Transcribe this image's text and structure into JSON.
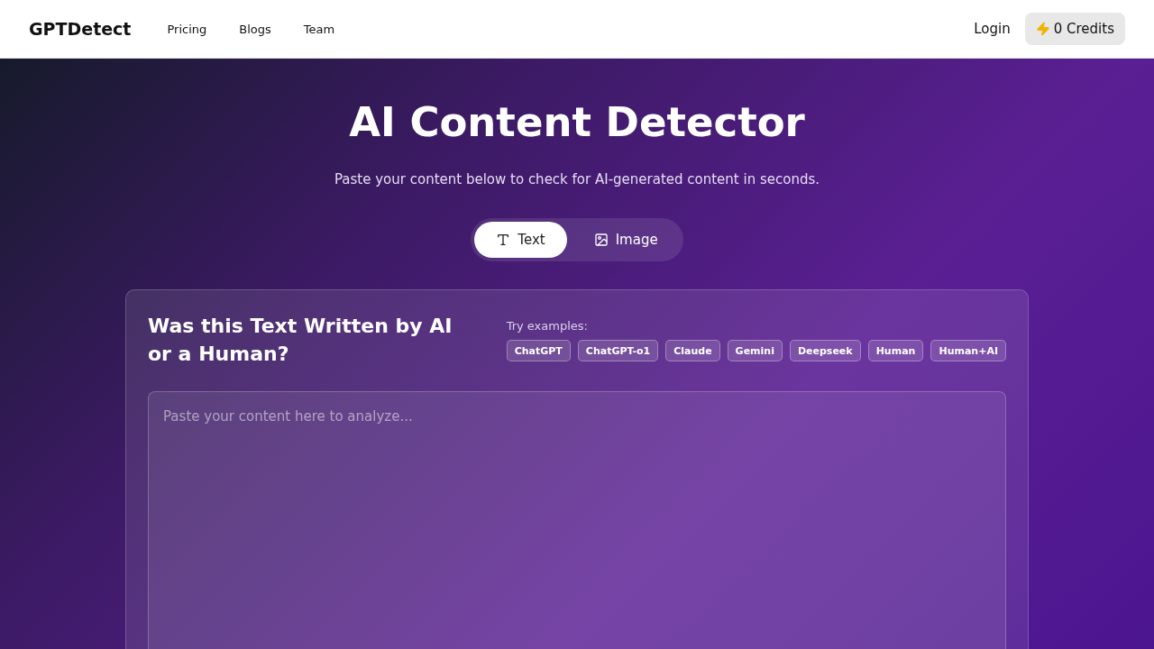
{
  "header": {
    "logo": "GPTDetect",
    "nav": [
      "Pricing",
      "Blogs",
      "Team"
    ],
    "login": "Login",
    "credits": "0 Credits"
  },
  "hero": {
    "title": "AI Content Detector",
    "subtitle": "Paste your content below to check for AI-generated content in seconds."
  },
  "tabs": [
    {
      "label": "Text",
      "kind": "text",
      "selected": true
    },
    {
      "label": "Image",
      "kind": "image",
      "selected": false
    }
  ],
  "card": {
    "heading": "Was this Text Written by AI or a Human?",
    "examples_label": "Try examples:",
    "examples": [
      "ChatGPT",
      "ChatGPT-o1",
      "Claude",
      "Gemini",
      "Deepseek",
      "Human",
      "Human+AI"
    ],
    "input": {
      "placeholder": "Paste your content here to analyze..."
    }
  }
}
